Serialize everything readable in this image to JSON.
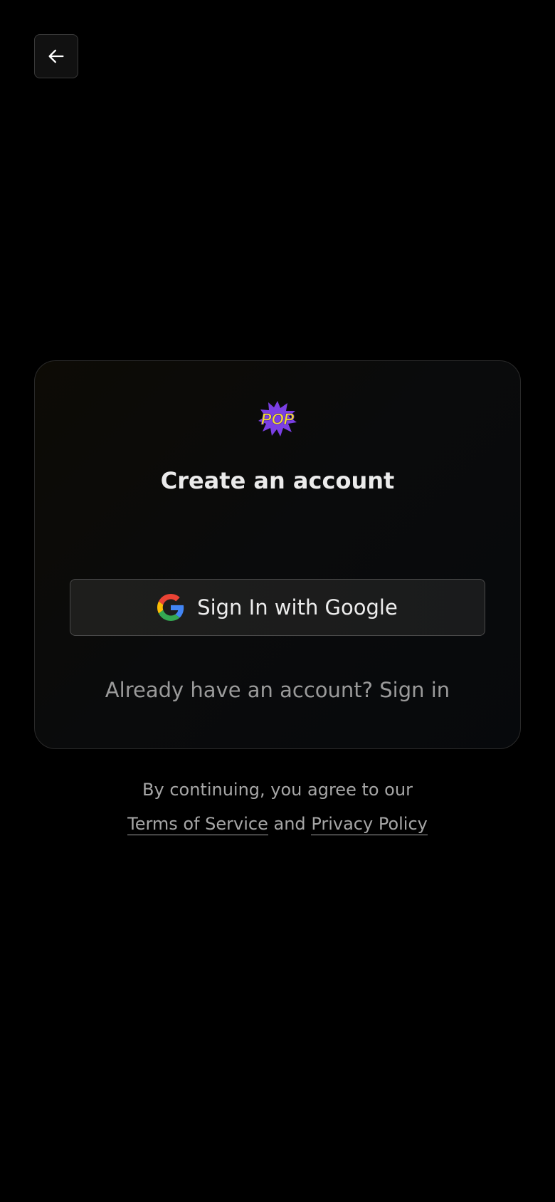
{
  "header": {
    "back_icon": "arrow-left-icon"
  },
  "card": {
    "logo_text": "POP",
    "title": "Create an account",
    "google_button_label": "Sign In with Google",
    "google_icon": "google-icon",
    "signin_prompt": "Already have an account? Sign in"
  },
  "legal": {
    "line1": "By continuing, you agree to our",
    "terms_label": "Terms of Service",
    "and_text": "and",
    "privacy_label": "Privacy Policy"
  },
  "colors": {
    "background": "#000000",
    "card_border": "#2a2a2a",
    "logo_yellow": "#f5e12a",
    "logo_purple": "#7b3fe4"
  }
}
